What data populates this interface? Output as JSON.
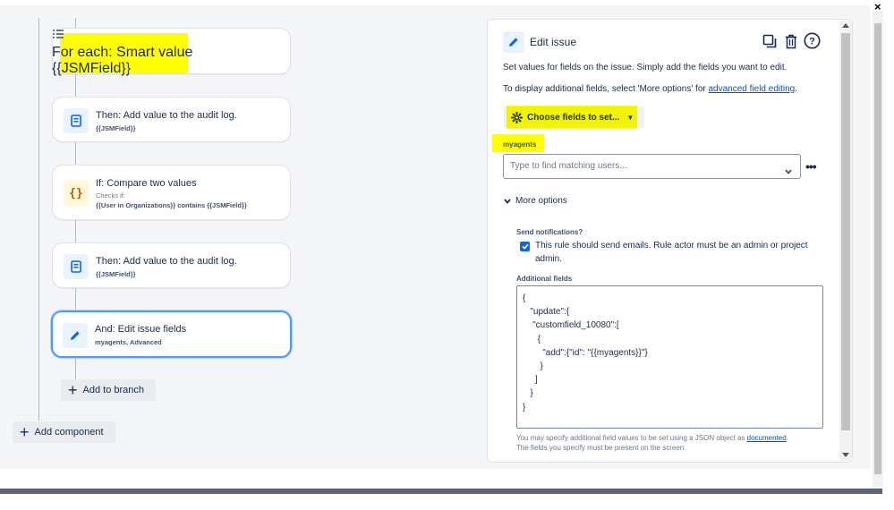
{
  "window": {
    "close_glyph": "×"
  },
  "flow": {
    "cards": [
      {
        "title": "For each: Smart value",
        "sub": "{{JSMField}}",
        "icon": "list-icon"
      },
      {
        "title": "Then: Add value to the audit log.",
        "sub": "{{JSMField}}",
        "icon": "audit-log-icon"
      },
      {
        "title": "If: Compare two values",
        "checks_label": "Checks if:",
        "sub": "{{User in Organizations}} contains {{JSMField}}",
        "icon": "braces-icon"
      },
      {
        "title": "Then: Add value to the audit log.",
        "sub": "{{JSMField}}",
        "icon": "audit-log-icon"
      },
      {
        "title": "And: Edit issue fields",
        "sub": "myagents, Advanced",
        "icon": "pencil-icon"
      }
    ],
    "add_to_branch": "Add to branch",
    "add_component": "Add component"
  },
  "panel": {
    "title": "Edit issue",
    "desc1": "Set values for fields on the issue. Simply add the fields you want to edit.",
    "desc2_prefix": "To display additional fields, select 'More options' for ",
    "desc2_link": "advanced field editing",
    "desc2_suffix": ".",
    "choose_fields": "Choose fields to set...",
    "field_label": "myagents",
    "field_placeholder": "Type to find matching users...",
    "more_options": "More options",
    "send_notifications_label": "Send notifications?",
    "checkbox_line1": "This rule should send emails. Rule actor must be an admin or project",
    "checkbox_line2": "admin.",
    "checkbox_checked": true,
    "additional_fields_label": "Additional fields",
    "json_value": "{\n   \"update\":{\n    \"customfield_10080\":[\n      {\n        \"add\":{\"id\": \"{{myagents}}\"}\n       }\n     ]\n   }\n}",
    "footer_line1_prefix": "You may specify additional field values to be set using a JSON object as ",
    "footer_link": "documented",
    "footer_line1_suffix": ".",
    "footer_line2": "The fields you specify must be present on the screen."
  },
  "colors": {
    "highlight": "#ffff00",
    "accent": "#0052cc",
    "selected_border": "#4c9aff"
  }
}
